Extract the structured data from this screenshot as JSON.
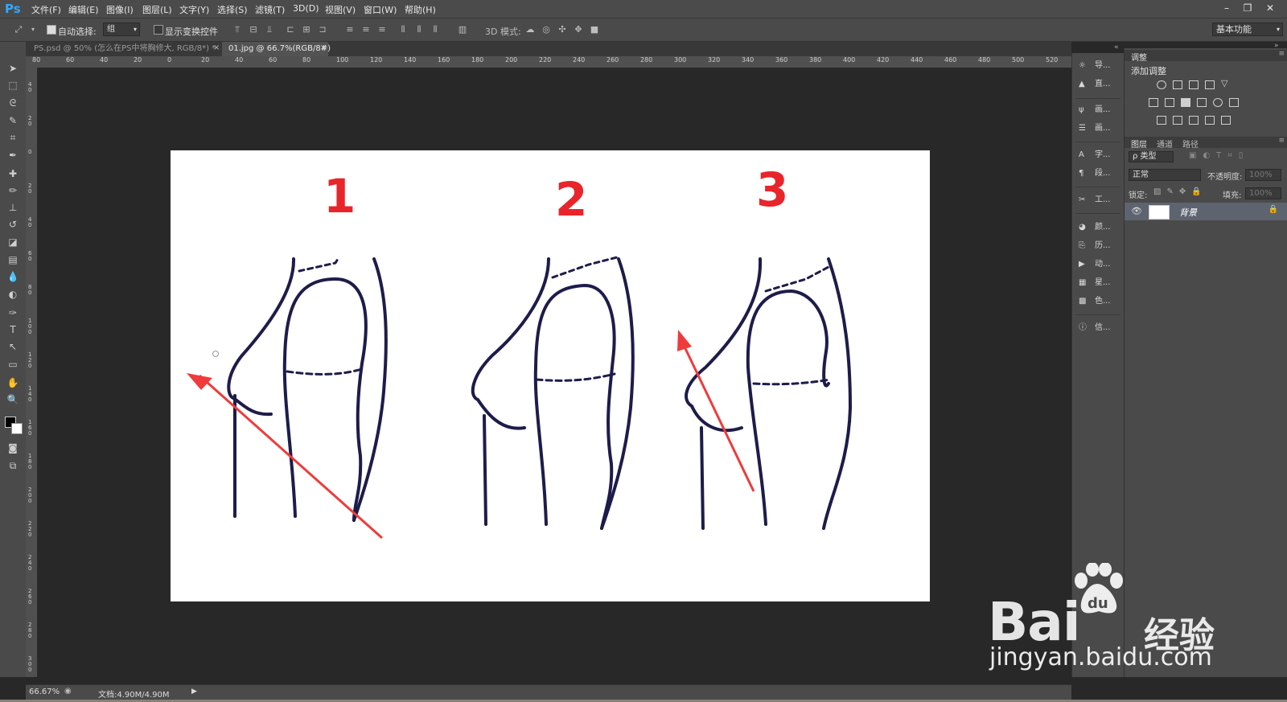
{
  "app": {
    "logo": "Ps"
  },
  "menu": [
    "文件(F)",
    "编辑(E)",
    "图像(I)",
    "图层(L)",
    "文字(Y)",
    "选择(S)",
    "滤镜(T)",
    "3D(D)",
    "视图(V)",
    "窗口(W)",
    "帮助(H)"
  ],
  "window_controls": {
    "minimize": "–",
    "restore": "❐",
    "close": "✕"
  },
  "options": {
    "auto_select_label": "自动选择:",
    "auto_select_value": "组",
    "show_transform_label": "显示变换控件",
    "mode_3d_label": "3D 模式:",
    "workspace": "基本功能"
  },
  "tabs": [
    {
      "title": "PS.psd @ 50% (怎么在PS中将胸修大, RGB/8*) *",
      "close": "×"
    },
    {
      "title": "01.jpg @ 66.7%(RGB/8#)",
      "close": "×"
    }
  ],
  "ruler_top_labels": [
    "80",
    "60",
    "40",
    "20",
    "0",
    "20",
    "40",
    "60",
    "80",
    "100",
    "120",
    "140",
    "160",
    "180",
    "200",
    "220",
    "240",
    "260",
    "280",
    "300",
    "320",
    "340",
    "360",
    "380",
    "400",
    "420",
    "440",
    "460",
    "480",
    "500",
    "520"
  ],
  "ruler_left_labels": [
    "4 0",
    "2 0",
    "0",
    "2 0",
    "4 0",
    "6 0",
    "8 0",
    "1 0 0",
    "1 2 0",
    "1 4 0",
    "1 6 0",
    "1 8 0",
    "2 0 0",
    "2 2 0",
    "2 4 0",
    "2 6 0",
    "2 8 0",
    "3 0 0"
  ],
  "image": {
    "numbers": [
      "1",
      "2",
      "3"
    ],
    "accent_color": "#e8252b",
    "arrow_color": "#ef3b3b"
  },
  "icon_strip": {
    "groups": [
      [
        {
          "icon": "navigator-icon",
          "label": "导..."
        },
        {
          "icon": "histogram-icon",
          "label": "直..."
        }
      ],
      [
        {
          "icon": "brush-icon",
          "label": "画..."
        },
        {
          "icon": "brush-settings-icon",
          "label": "画..."
        }
      ],
      [
        {
          "icon": "character-icon",
          "label": "字..."
        },
        {
          "icon": "paragraph-icon",
          "label": "段..."
        }
      ],
      [
        {
          "icon": "tool-presets-icon",
          "label": "工..."
        }
      ],
      [
        {
          "icon": "color-icon",
          "label": "颜..."
        },
        {
          "icon": "history-icon",
          "label": "历..."
        },
        {
          "icon": "actions-icon",
          "label": "动..."
        },
        {
          "icon": "swatches-icon",
          "label": "星..."
        },
        {
          "icon": "styles-icon",
          "label": "色..."
        }
      ],
      [
        {
          "icon": "info-icon",
          "label": "信..."
        }
      ]
    ]
  },
  "adjustments": {
    "tab": "调整",
    "add_label": "添加调整"
  },
  "layers": {
    "tabs": [
      "图层",
      "通道",
      "路径"
    ],
    "filter_label": "ρ 类型",
    "blend_mode": "正常",
    "opacity_label": "不透明度:",
    "opacity_value": "100%",
    "lock_label": "锁定:",
    "fill_label": "填充:",
    "fill_value": "100%",
    "items": [
      {
        "name": "背景"
      }
    ]
  },
  "status": {
    "zoom": "66.67%",
    "doc": "文档:4.90M/4.90M"
  },
  "watermark": {
    "brand": "Bai",
    "brand_suffix": "经验",
    "url": "jingyan.baidu.com"
  }
}
